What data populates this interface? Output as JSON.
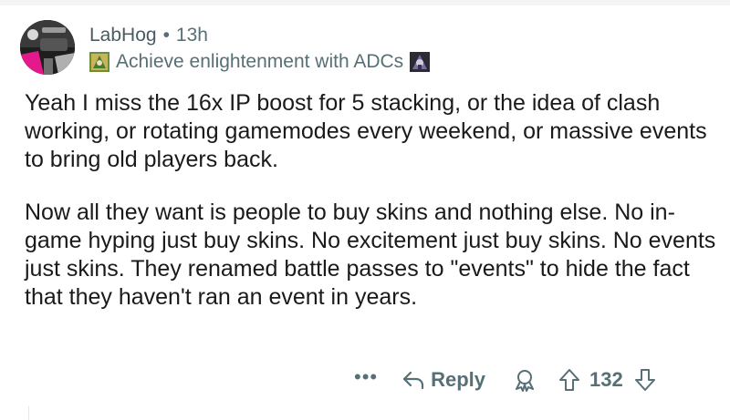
{
  "comment": {
    "author": "LabHog",
    "separator": "•",
    "time_ago": "13h",
    "flair": {
      "text": "Achieve enlightenment with ADCs",
      "left_icon": "flair-emoji-left-icon",
      "right_icon": "flair-emoji-right-icon"
    },
    "avatar": {
      "icon": "user-avatar",
      "accent_color": "#e6198c"
    },
    "paragraphs": [
      "Yeah I miss the 16x IP boost for 5 stacking, or the idea of clash working, or rotating gamemodes every weekend, or massive events to bring old players back.",
      "Now all they want is people to buy skins and nothing else. No in-game hyping just buy skins. No excitement just buy skins. No events just skins. They renamed battle passes to \"events\" to hide the fact that they haven't ran an event in years."
    ]
  },
  "actions": {
    "more_label": "•••",
    "reply_label": "Reply",
    "vote_count": "132",
    "icons": {
      "reply": "reply-arrow-icon",
      "award": "award-icon",
      "upvote": "upvote-arrow-icon",
      "downvote": "downvote-arrow-icon"
    }
  },
  "colors": {
    "text_primary": "#1a1a1b",
    "text_meta": "#576f76",
    "background": "#ffffff"
  }
}
